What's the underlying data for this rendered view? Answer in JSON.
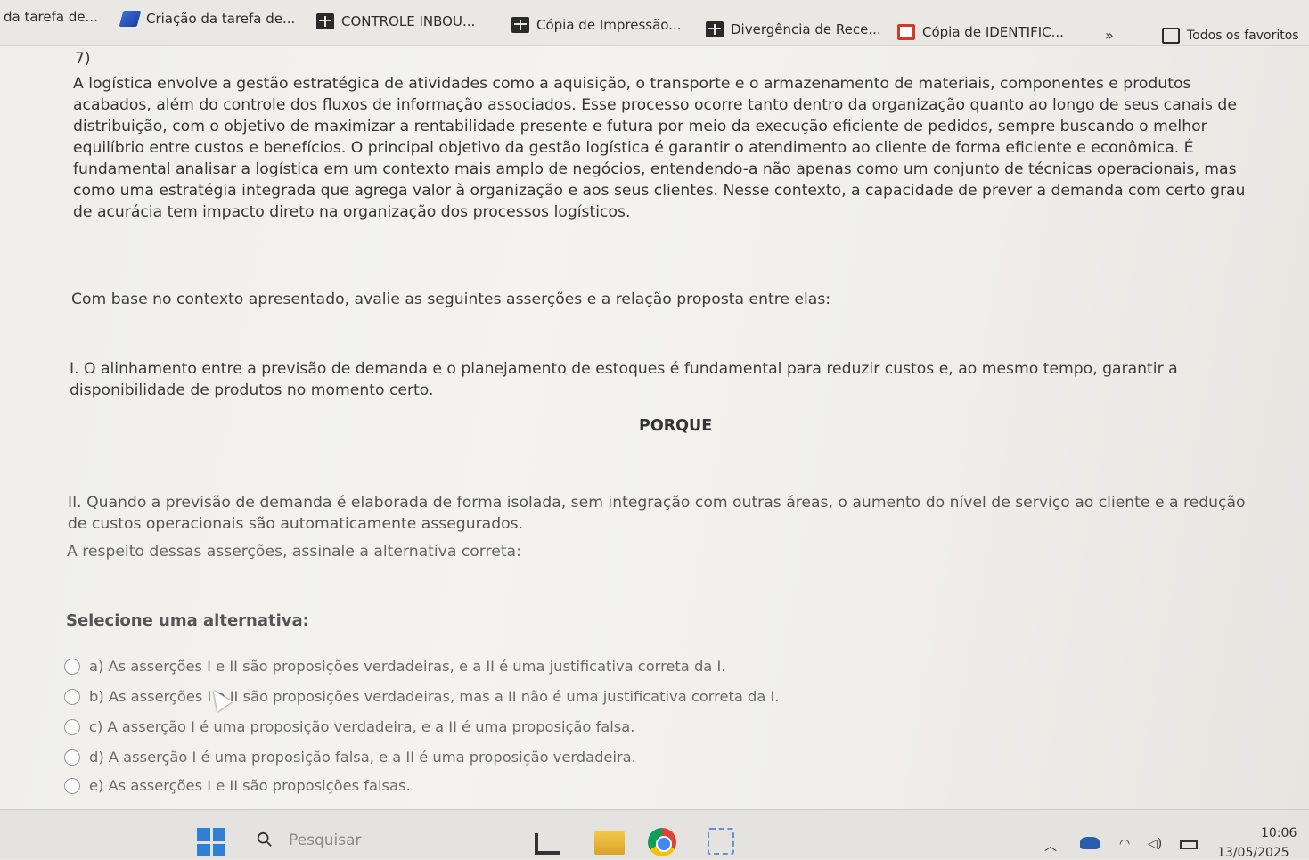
{
  "bookmarks": {
    "items": [
      {
        "label": "da tarefa de...",
        "icon": "none"
      },
      {
        "label": "Criação da tarefa de...",
        "icon": "azure-devops-icon"
      },
      {
        "label": "CONTROLE INBOU...",
        "icon": "sheets-icon"
      },
      {
        "label": "Cópia de Impressão...",
        "icon": "sheets-icon"
      },
      {
        "label": "Divergência de Rece...",
        "icon": "sheets-icon"
      },
      {
        "label": "Cópia de IDENTIFIC...",
        "icon": "slides-icon"
      }
    ],
    "more_label": "»",
    "all_favorites_label": "Todos os favoritos"
  },
  "question": {
    "number": "7)",
    "paragraph": "A logística envolve a gestão estratégica de atividades como a aquisição, o transporte e o armazenamento de materiais, componentes e produtos acabados, além do controle dos fluxos de informação associados. Esse processo ocorre tanto dentro da organização quanto ao longo de seus canais de distribuição, com o objetivo de maximizar a rentabilidade presente e futura por meio da execução eficiente de pedidos, sempre buscando o melhor equilíbrio entre custos e benefícios. O principal objetivo da gestão logística é garantir o atendimento ao cliente de forma eficiente e econômica. É fundamental analisar a logística em um contexto mais amplo de negócios, entendendo-a não apenas como um conjunto de técnicas operacionais, mas como uma estratégia integrada que agrega valor à organização e aos seus clientes. Nesse contexto, a capacidade de prever a demanda com certo grau de acurácia tem impacto direto na organização dos processos logísticos.",
    "prompt": "Com base no contexto apresentado, avalie as seguintes asserções e a relação proposta entre elas:",
    "assertion_1": "I. O alinhamento entre a previsão de demanda e o planejamento de estoques é fundamental para reduzir custos e, ao mesmo tempo, garantir a disponibilidade de produtos no momento certo.",
    "connector": "PORQUE",
    "assertion_2": "II. Quando a previsão de demanda é elaborada de forma isolada, sem integração com outras áreas, o aumento do nível de serviço ao cliente e a redução de custos operacionais são automaticamente assegurados.",
    "ask": "A respeito dessas asserções, assinale a alternativa correta:",
    "select_label": "Selecione uma alternativa:",
    "options": [
      "a) As asserções I e II são proposições verdadeiras, e a II é uma justificativa correta da I.",
      "b) As asserções I e II são proposições verdadeiras, mas a II não é uma justificativa correta da I.",
      "c) A asserção I é uma proposição verdadeira, e a II é uma proposição falsa.",
      "d) A asserção I é uma proposição falsa, e a II é uma proposição verdadeira.",
      "e) As asserções I e II são proposições falsas."
    ]
  },
  "taskbar": {
    "search_placeholder": "Pesquisar",
    "time": "10:06",
    "date": "13/05/2025"
  }
}
